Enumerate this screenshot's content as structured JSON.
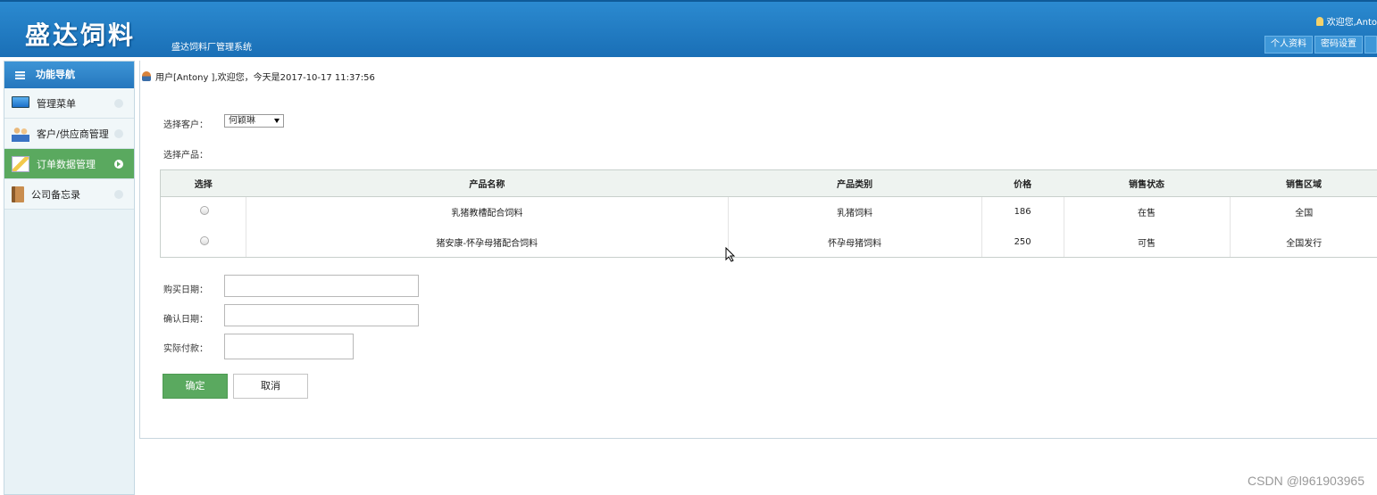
{
  "header": {
    "logo": "盛达饲料",
    "subtitle": "盛达饲料厂管理系统",
    "welcome": "欢迎您,Anto",
    "links": [
      "个人资料",
      "密码设置"
    ]
  },
  "sidebar": {
    "title": "功能导航",
    "items": [
      {
        "label": "管理菜单",
        "icon": "monitor-icon"
      },
      {
        "label": "客户/供应商管理",
        "icon": "people-icon"
      },
      {
        "label": "订单数据管理",
        "icon": "edit-icon"
      },
      {
        "label": "公司备忘录",
        "icon": "book-icon"
      }
    ],
    "active_index": 2
  },
  "main": {
    "greeting": "用户[Antony ],欢迎您，今天是2017-10-17 11:37:56",
    "customer_label": "选择客户：",
    "customer_value": "何颖琳",
    "product_label": "选择产品：",
    "table": {
      "headers": [
        "选择",
        "产品名称",
        "产品类别",
        "价格",
        "销售状态",
        "销售区域"
      ],
      "rows": [
        {
          "name": "乳猪教槽配合饲料",
          "category": "乳猪饲料",
          "price": "186",
          "status": "在售",
          "region": "全国"
        },
        {
          "name": "猪安康-怀孕母猪配合饲料",
          "category": "怀孕母猪饲料",
          "price": "250",
          "status": "可售",
          "region": "全国发行"
        }
      ]
    },
    "purchase_date_label": "购买日期：",
    "confirm_date_label": "确认日期：",
    "payment_label": "实际付款：",
    "ok_button": "确定",
    "cancel_button": "取消"
  },
  "watermark": "CSDN @l961903965"
}
